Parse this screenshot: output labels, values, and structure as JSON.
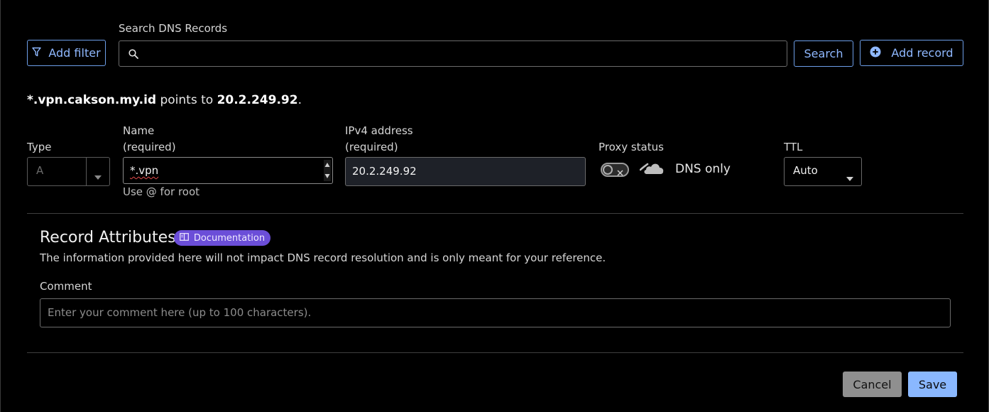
{
  "toolbar": {
    "add_filter_label": "Add filter",
    "search_label": "Search DNS Records",
    "search_value": "",
    "search_button_label": "Search",
    "add_record_label": "Add record"
  },
  "summary": {
    "name": "*.vpn.cakson.my.id",
    "middle": "points to",
    "target": "20.2.249.92",
    "end": "."
  },
  "form": {
    "type_label": "Type",
    "type_value": "A",
    "name_label_line1": "Name",
    "name_label_line2": "(required)",
    "name_value": "*.vpn",
    "name_hint": "Use @ for root",
    "ipv4_label_line1": "IPv4 address",
    "ipv4_label_line2": "(required)",
    "ipv4_value": "20.2.249.92",
    "proxy_label": "Proxy status",
    "proxy_value": "DNS only",
    "proxy_enabled": false,
    "ttl_label": "TTL",
    "ttl_value": "Auto"
  },
  "attributes": {
    "title": "Record Attributes",
    "doc_badge": "Documentation",
    "description": "The information provided here will not impact DNS record resolution and is only meant for your reference.",
    "comment_label": "Comment",
    "comment_placeholder": "Enter your comment here (up to 100 characters).",
    "comment_value": ""
  },
  "actions": {
    "cancel_label": "Cancel",
    "save_label": "Save"
  },
  "colors": {
    "accent": "#8ab8ff",
    "badge": "#6b4ed8",
    "background": "#000000"
  }
}
